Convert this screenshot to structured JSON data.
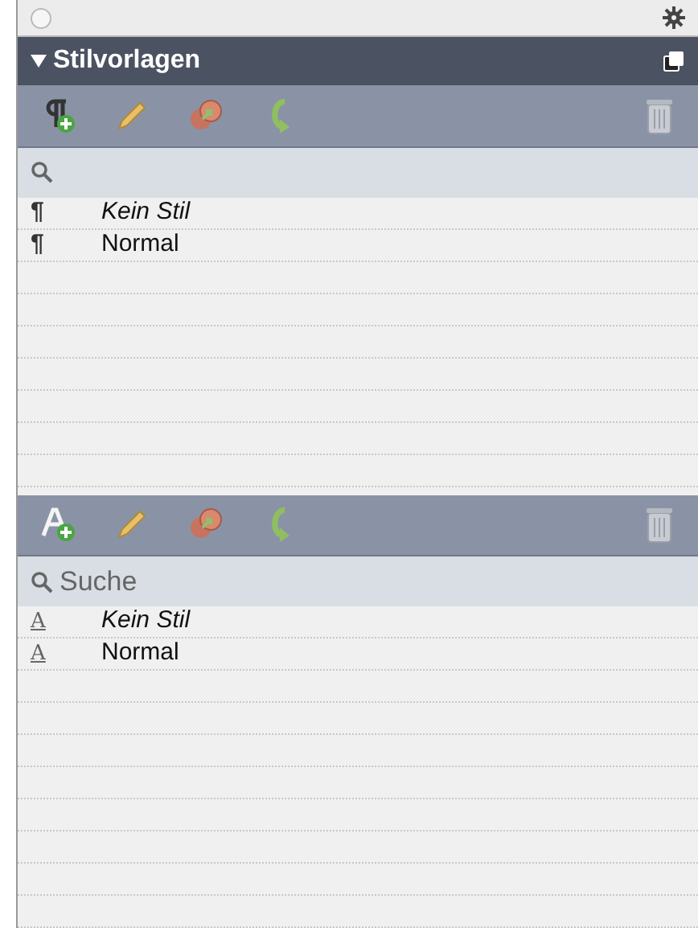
{
  "panel": {
    "title": "Stilvorlagen",
    "expanded": true
  },
  "paragraph_styles": {
    "items": [
      {
        "marker": "¶",
        "name": "Kein Stil",
        "italic": true
      },
      {
        "marker": "¶",
        "name": "Normal",
        "italic": false
      }
    ]
  },
  "character_styles": {
    "search": {
      "placeholder": "Suche"
    },
    "items": [
      {
        "marker": "A",
        "name": "Kein Stil",
        "italic": true
      },
      {
        "marker": "A",
        "name": "Normal",
        "italic": false
      }
    ]
  }
}
